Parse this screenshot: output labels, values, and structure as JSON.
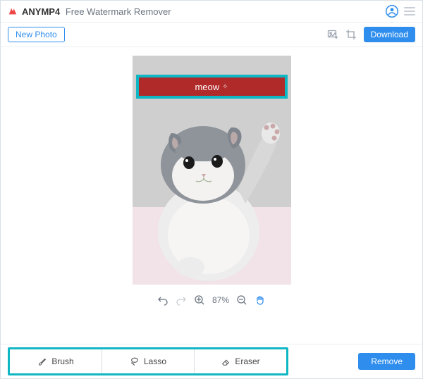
{
  "header": {
    "brand_strong": "ANYMP4",
    "brand_rest": "Free Watermark Remover",
    "user_icon": "user-circle-icon",
    "menu_icon": "hamburger-icon"
  },
  "actions": {
    "new_photo_label": "New Photo",
    "download_label": "Download",
    "add_image_icon": "image-add-icon",
    "crop_icon": "crop-icon"
  },
  "canvas": {
    "watermark_text": "meow",
    "selection_color": "#0fb6c4",
    "watermark_bg": "#b12a2a"
  },
  "zoom": {
    "undo_icon": "undo-icon",
    "redo_icon": "redo-icon",
    "zoom_in_icon": "zoom-in-icon",
    "zoom_level": "87%",
    "zoom_out_icon": "zoom-out-icon",
    "hand_icon": "hand-icon"
  },
  "tools": [
    {
      "icon": "brush-icon",
      "label": "Brush"
    },
    {
      "icon": "lasso-icon",
      "label": "Lasso"
    },
    {
      "icon": "eraser-icon",
      "label": "Eraser"
    }
  ],
  "bottom": {
    "remove_label": "Remove"
  }
}
